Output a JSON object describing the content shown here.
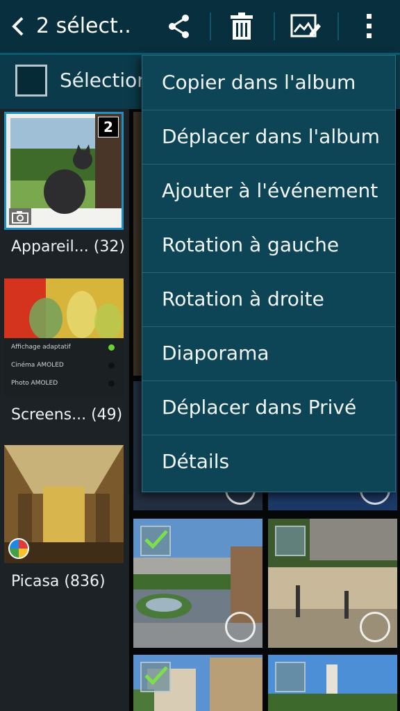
{
  "header": {
    "title": "2 sélect..",
    "accent_color": "#0b5b75"
  },
  "toolbar": {
    "icons": [
      "back-icon",
      "share-icon",
      "trash-icon",
      "edit-image-icon",
      "overflow-menu-icon"
    ]
  },
  "select_bar": {
    "label": "Sélection"
  },
  "albums": [
    {
      "label": "Appareil... (32)",
      "badge": "2",
      "icon": "camera-icon"
    },
    {
      "label": "Screens... (49)",
      "screenshot_rows": [
        "Affichage adaptatif",
        "Cinéma AMOLED",
        "Photo AMOLED"
      ]
    },
    {
      "label": "Picasa (836)",
      "icon": "picasa-icon"
    }
  ],
  "menu": {
    "items": [
      "Copier dans l'album",
      "Déplacer dans l'album",
      "Ajouter à l'événement",
      "Rotation à gauche",
      "Rotation à droite",
      "Diaporama",
      "Déplacer dans Privé",
      "Détails"
    ]
  }
}
